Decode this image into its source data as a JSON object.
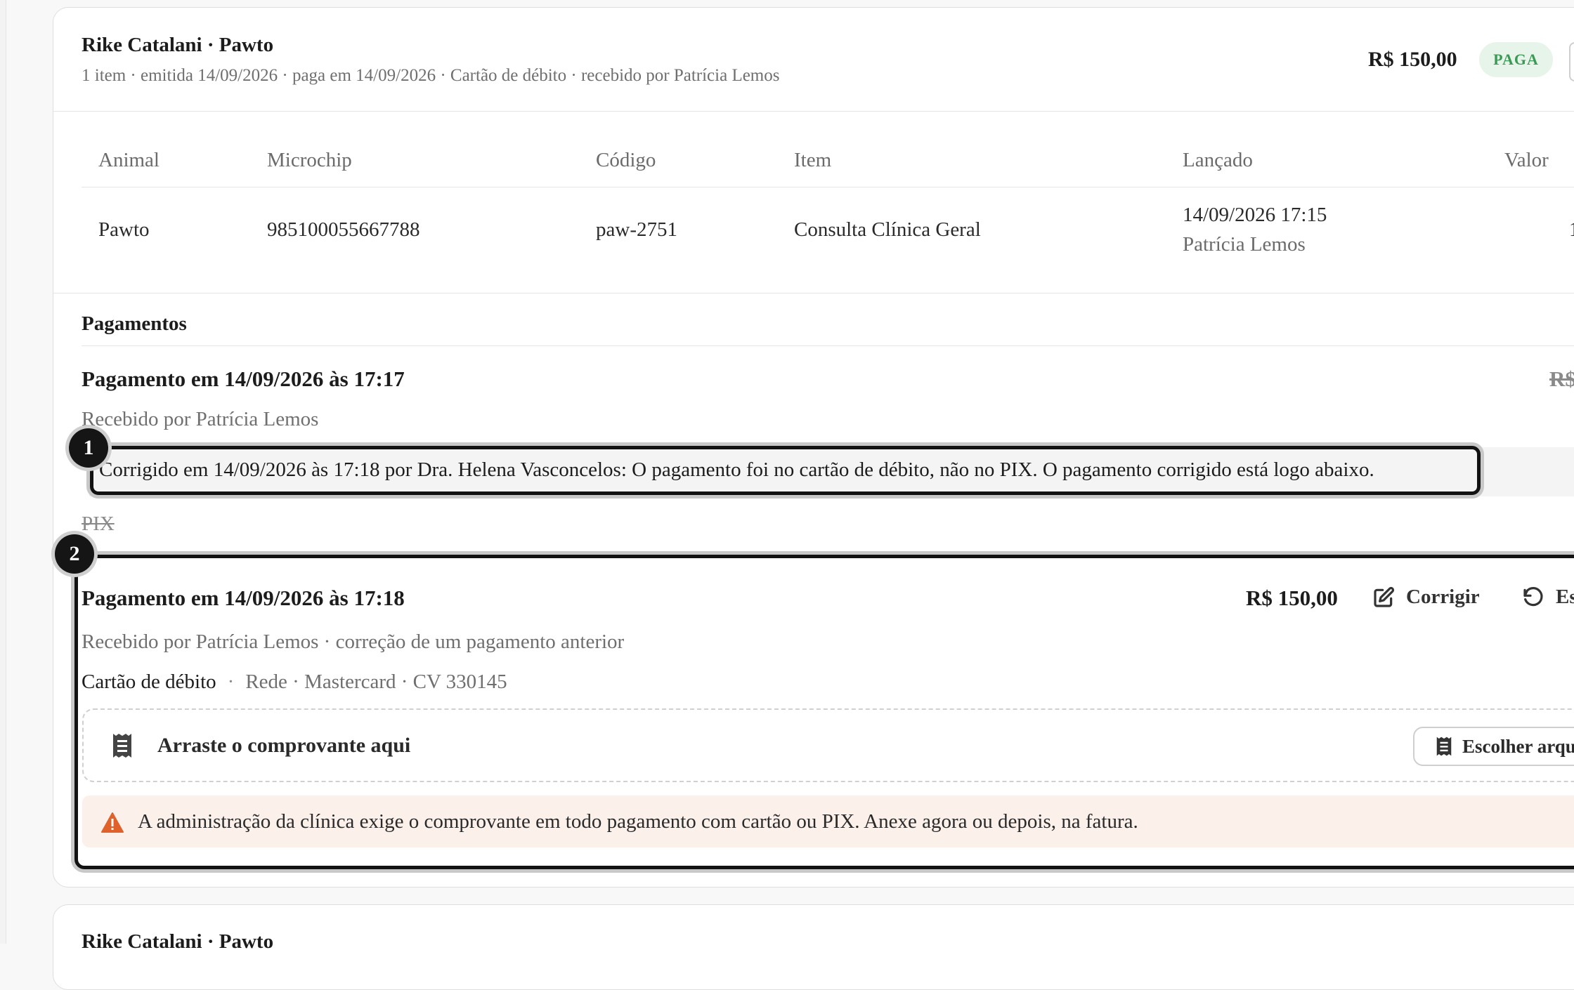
{
  "invoice": {
    "title": "Rike Catalani · Pawto",
    "subtitle": "1 item · emitida 14/09/2026 · paga em 14/09/2026 · Cartão de débito · recebido por Patrícia Lemos",
    "total": "R$ 150,00",
    "status": "PAGA",
    "status_color": "#3a9a55"
  },
  "table": {
    "headers": [
      "Animal",
      "Microchip",
      "Código",
      "Item",
      "Lançado",
      "Valor"
    ],
    "row": {
      "animal": "Pawto",
      "microchip": "985100055667788",
      "codigo": "paw-2751",
      "item": "Consulta Clínica Geral",
      "lancado_date": "14/09/2026 17:15",
      "lancado_by": "Patrícia Lemos",
      "valor_partial": "1"
    }
  },
  "payments": {
    "section_title": "Pagamentos",
    "original": {
      "title": "Pagamento em 14/09/2026 às 17:17",
      "amount_partial": "R$",
      "received_by": "Recebido por Patrícia Lemos",
      "correction_note": "Corrigido em 14/09/2026 às 17:18 por Dra. Helena Vasconcelos: O pagamento foi no cartão de débito, não no PIX. O pagamento corrigido está logo abaixo.",
      "method": "PIX"
    },
    "corrected": {
      "title": "Pagamento em 14/09/2026 às 17:18",
      "amount": "R$ 150,00",
      "edit_label": "Corrigir",
      "undo_label": "Es",
      "received_by": "Recebido por Patrícia Lemos · correção de um pagamento anterior",
      "method": "Cartão de débito",
      "method_sep": "·",
      "method_details": "Rede · Mastercard · CV 330145",
      "dropzone_label": "Arraste o comprovante aqui",
      "choose_label": "Escolher arquivo",
      "warning": "A administração da clínica exige o comprovante em todo pagamento com cartão ou PIX. Anexe agora ou depois, na fatura.",
      "warning_color": "#e0612a"
    }
  },
  "markers": [
    "1",
    "2"
  ],
  "next_invoice": {
    "title": "Rike Catalani · Pawto"
  }
}
